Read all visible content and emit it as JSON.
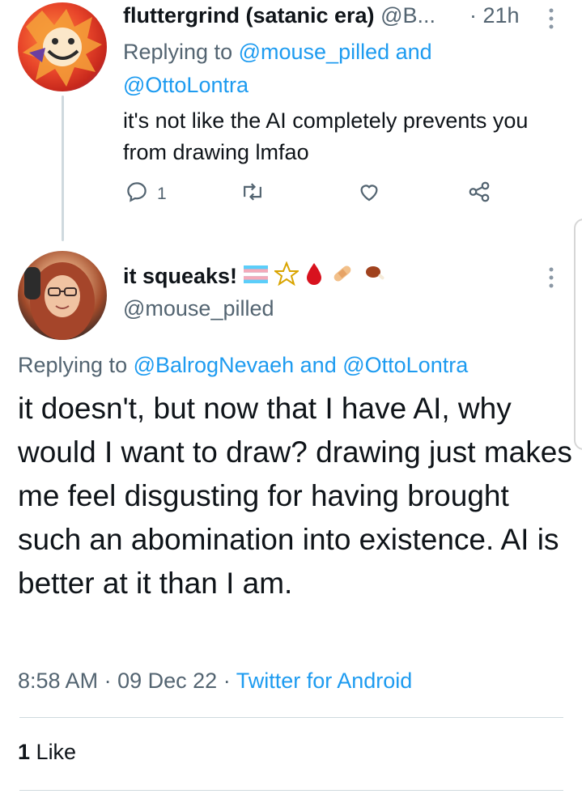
{
  "tweet1": {
    "display_name": "fluttergrind (satanic era)",
    "handle": "@B...",
    "time_sep": "·",
    "time": "21h",
    "replying_prefix": "Replying to",
    "replying_user1": "@mouse_pilled",
    "replying_and": "and",
    "replying_user2": "@OttoLontra",
    "text": "it's not like the AI completely prevents you from drawing lmfao",
    "reply_count": "1",
    "icons": [
      "reply-icon",
      "retweet-icon",
      "like-icon",
      "share-icon",
      "more-icon"
    ]
  },
  "tweet2": {
    "display_name": "it squeaks!",
    "handle": "@mouse_pilled",
    "badges": [
      "transgender-flag-icon",
      "pentagram-icon",
      "blood-drop-icon",
      "bandage-icon",
      "meat-icon"
    ],
    "replying_prefix": "Replying to",
    "replying_user1": "@BalrogNevaeh",
    "replying_and": "and",
    "replying_user2": "@OttoLontra",
    "text": "it doesn't, but now that I have AI, why would I want to draw? drawing just makes me feel disgusting for having brought such an abomination into existence. AI is better at it than I am.",
    "time": "8:58 AM",
    "sep1": "·",
    "date": "09 Dec 22",
    "sep2": "·",
    "source": "Twitter for Android",
    "like_count": "1",
    "like_label": "Like"
  },
  "colors": {
    "link_blue": "#1d9bf0",
    "muted_gray": "#536471",
    "text_dark": "#0f1419",
    "border": "#cfd9de"
  }
}
